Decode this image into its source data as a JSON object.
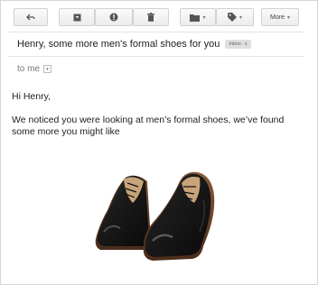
{
  "toolbar": {
    "reply_icon": "reply-icon",
    "archive_icon": "archive-icon",
    "report_icon": "report-spam-icon",
    "delete_icon": "trash-icon",
    "move_icon": "folder-icon",
    "labels_icon": "tag-icon",
    "more_label": "More"
  },
  "email": {
    "subject": "Henry, some more men's formal shoes for you",
    "label_chip": "Inbox",
    "label_chip_close": "x",
    "recipient_line": "to me",
    "greeting": "Hi Henry,",
    "body": "We noticed you were looking at men’s formal shoes, we’ve found some more you might like"
  },
  "image": {
    "subject": "pair-of-black-formal-shoes"
  }
}
